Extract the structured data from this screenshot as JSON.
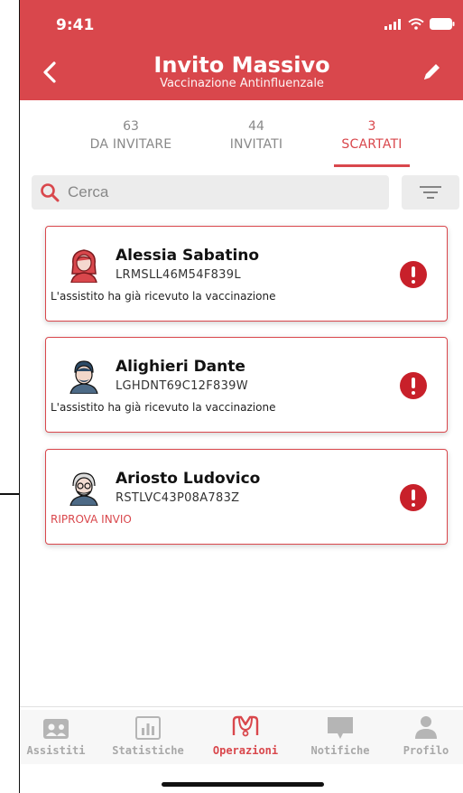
{
  "status": {
    "time": "9:41"
  },
  "header": {
    "title": "Invito Massivo",
    "subtitle": "Vaccinazione Antinfluenzale",
    "color": "#d9474c"
  },
  "tabs": [
    {
      "count": "63",
      "label": "DA INVITARE",
      "active": false
    },
    {
      "count": "44",
      "label": "INVITATI",
      "active": false
    },
    {
      "count": "3",
      "label": "SCARTATI",
      "active": true
    }
  ],
  "search": {
    "placeholder": "Cerca"
  },
  "cards": [
    {
      "name": "Alessia Sabatino",
      "code": "LRMSLL46M54F839L",
      "note": "L'assistito ha già ricevuto la vaccinazione",
      "avatar": "woman-avatar-icon"
    },
    {
      "name": "Alighieri Dante",
      "code": "LGHDNT69C12F839W",
      "note": "L'assistito ha già ricevuto la vaccinazione",
      "avatar": "man-avatar-icon"
    },
    {
      "name": "Ariosto Ludovico",
      "code": "RSTLVC43P08A783Z",
      "note": "RIPROVA INVIO",
      "avatar": "elder-man-avatar-icon"
    }
  ],
  "nav": [
    {
      "label": "Assistiti",
      "icon": "id-card-icon",
      "active": false
    },
    {
      "label": "Statistiche",
      "icon": "bar-chart-icon",
      "active": false
    },
    {
      "label": "Operazioni",
      "icon": "stethoscope-icon",
      "active": true
    },
    {
      "label": "Notifiche",
      "icon": "chat-bubble-icon",
      "active": false
    },
    {
      "label": "Profilo",
      "icon": "person-icon",
      "active": false
    }
  ]
}
